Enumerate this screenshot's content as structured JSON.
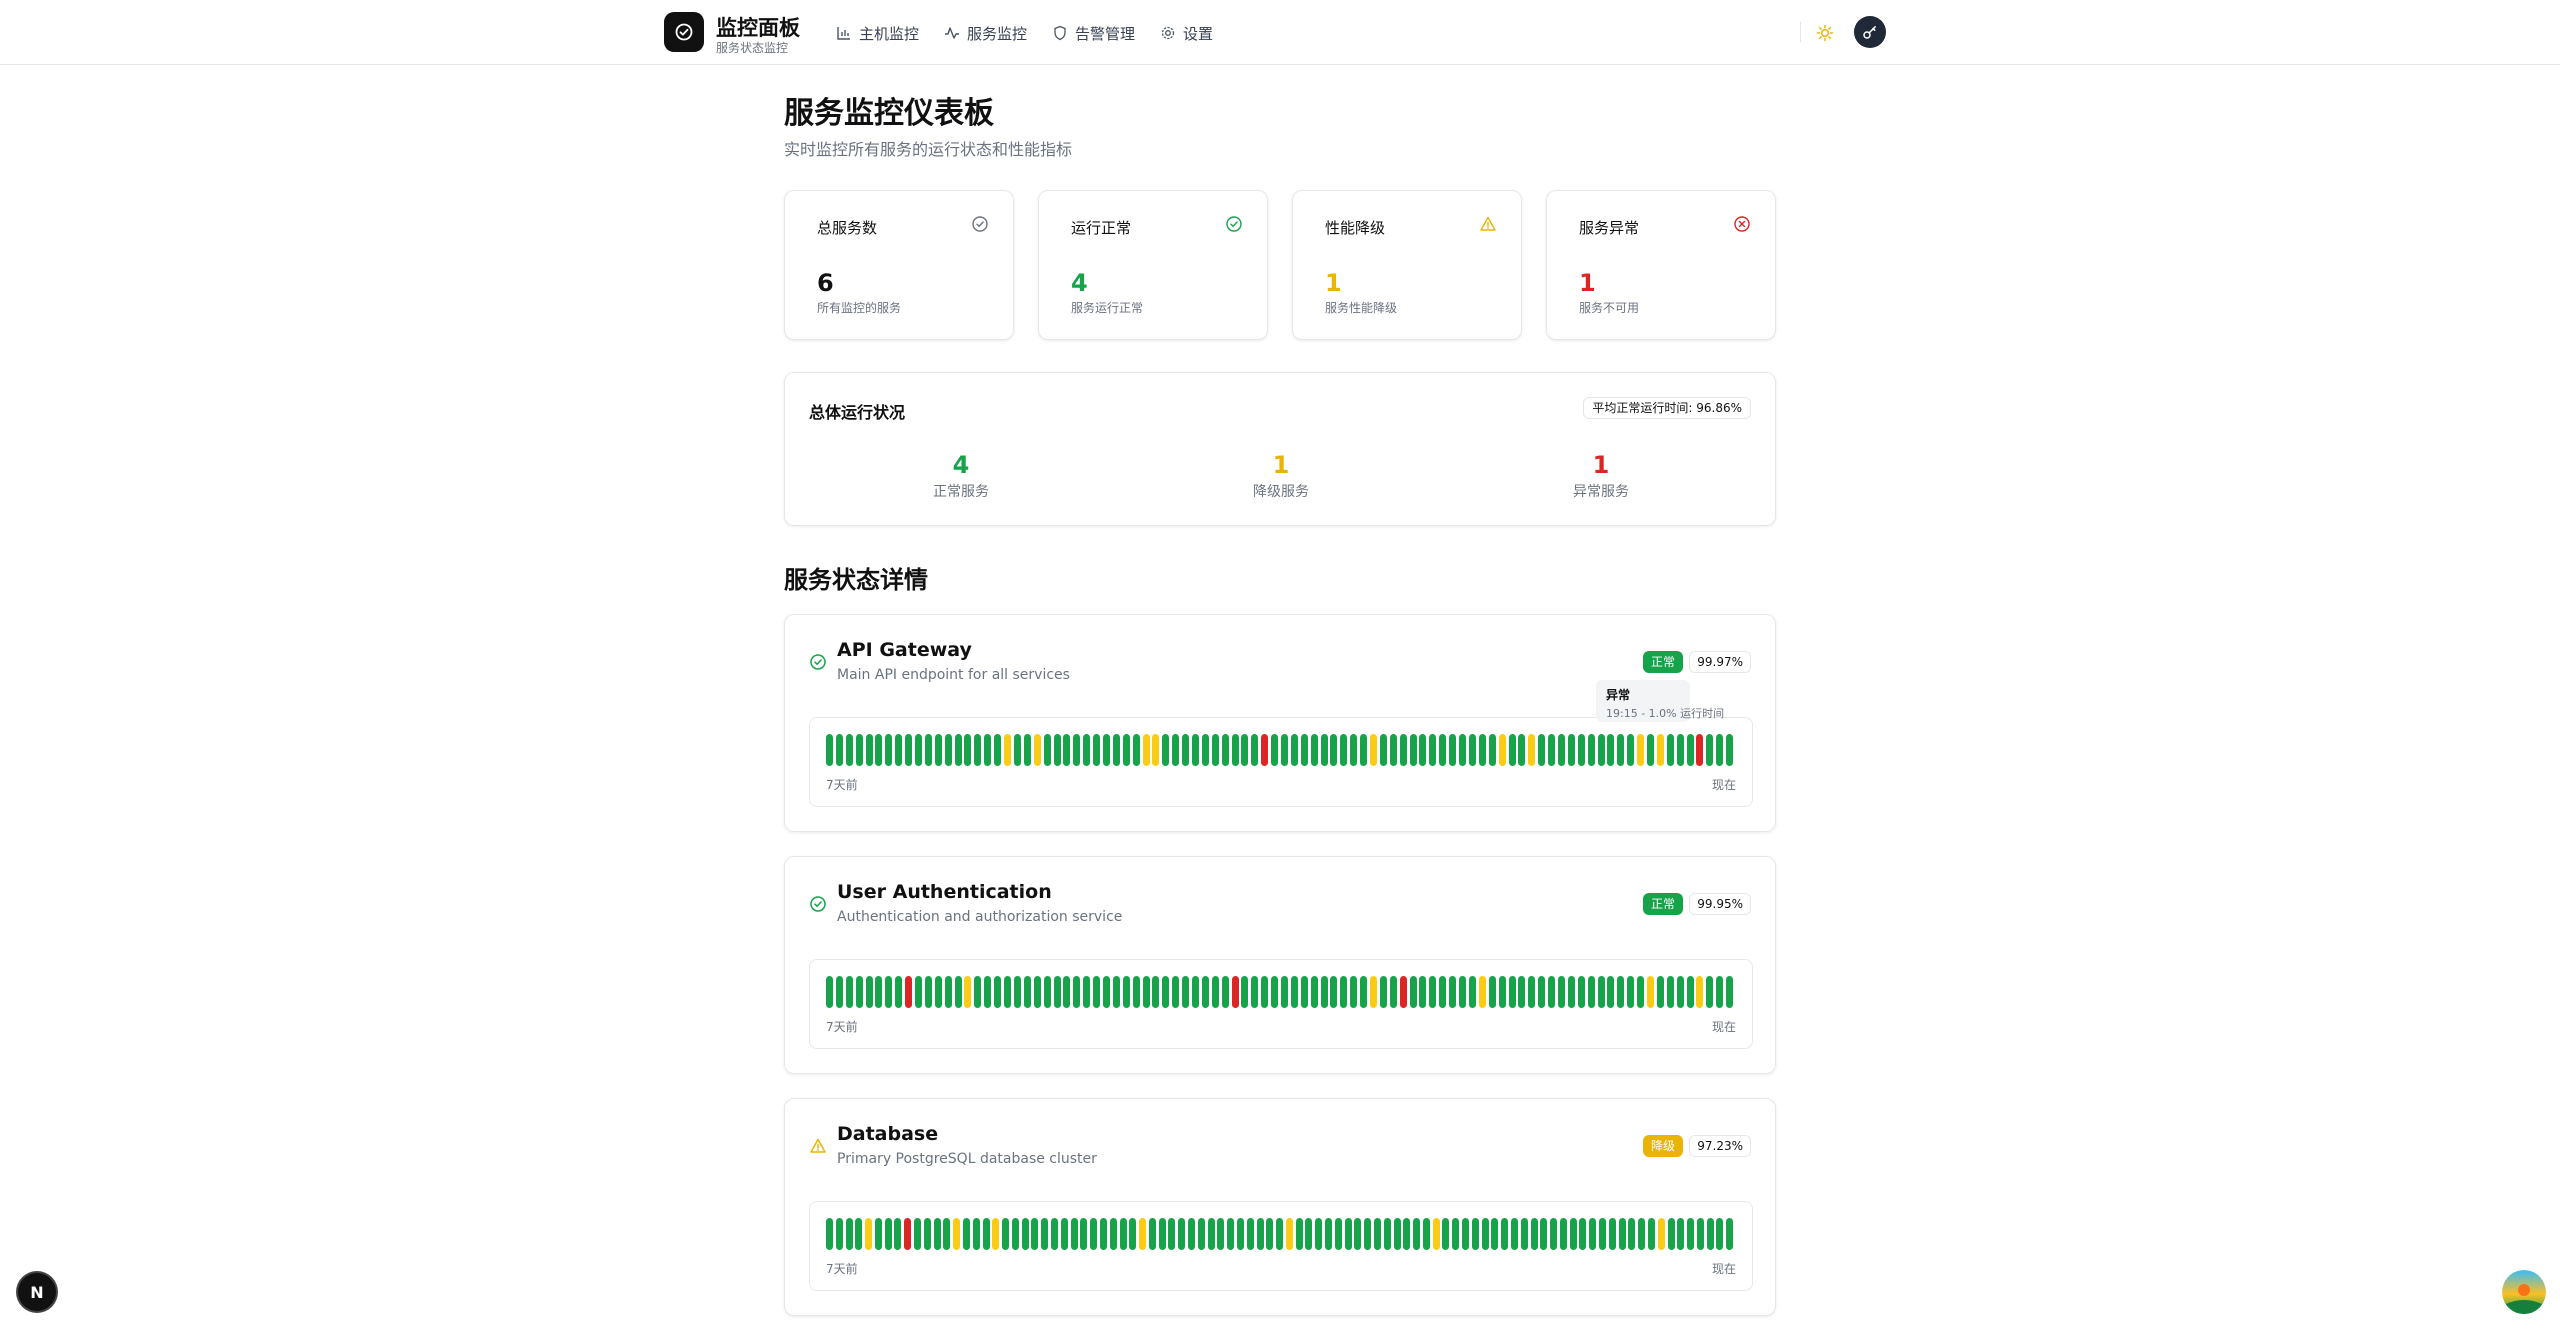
{
  "header": {
    "brand_title": "监控面板",
    "brand_subtitle": "服务状态监控",
    "nav": [
      {
        "label": "主机监控",
        "icon": "bar-chart-icon"
      },
      {
        "label": "服务监控",
        "icon": "activity-icon"
      },
      {
        "label": "告警管理",
        "icon": "shield-icon"
      },
      {
        "label": "设置",
        "icon": "gear-icon"
      }
    ],
    "theme_icon": "sun-icon",
    "user_icon": "key-icon"
  },
  "page": {
    "title": "服务监控仪表板",
    "subtitle": "实时监控所有服务的运行状态和性能指标"
  },
  "stats": [
    {
      "label": "总服务数",
      "value": "6",
      "note": "所有监控的服务",
      "color": "#111111",
      "icon": "check-circle-icon"
    },
    {
      "label": "运行正常",
      "value": "4",
      "note": "服务运行正常",
      "color": "#16a34a",
      "icon": "check-circle-icon"
    },
    {
      "label": "性能降级",
      "value": "1",
      "note": "服务性能降级",
      "color": "#eab308",
      "icon": "warning-icon"
    },
    {
      "label": "服务异常",
      "value": "1",
      "note": "服务不可用",
      "color": "#dc2626",
      "icon": "x-circle-icon"
    }
  ],
  "overall": {
    "title": "总体运行状况",
    "uptime_badge": "平均正常运行时间: 96.86%",
    "columns": [
      {
        "value": "4",
        "label": "正常服务",
        "color": "#16a34a"
      },
      {
        "value": "1",
        "label": "降级服务",
        "color": "#eab308"
      },
      {
        "value": "1",
        "label": "异常服务",
        "color": "#dc2626"
      }
    ]
  },
  "section_title": "服务状态详情",
  "status_colors": {
    "up": "#16a34a",
    "degraded": "#facc15",
    "down": "#dc2626"
  },
  "services": [
    {
      "name": "API Gateway",
      "description": "Main API endpoint for all services",
      "status_label": "正常",
      "status": "up",
      "uptime": "99.97%",
      "axis_start": "7天前",
      "axis_end": "现在",
      "history": "ggggggggggggggggggyggyggggggggggyyggggggggggrggggggggggyggggggggggggyggyggggggggggygygggrggg"
    },
    {
      "name": "User Authentication",
      "description": "Authentication and authorization service",
      "status_label": "正常",
      "status": "up",
      "uptime": "99.95%",
      "axis_start": "7天前",
      "axis_end": "现在",
      "history": "ggggggggrgggggyggggggggggggggggggggggggggrgggggggggggggyggrgggggggyggggggggggggggggyggggyggg"
    },
    {
      "name": "Database",
      "description": "Primary PostgreSQL database cluster",
      "status_label": "降级",
      "status": "degraded",
      "uptime": "97.23%",
      "axis_start": "7天前",
      "axis_end": "现在",
      "history": "ggggygggrggggygggyggggggggggggggyggggggggggggggyggggggggggggggyggggggggggggggggggggggyggggggg"
    }
  ],
  "tooltip": {
    "title": "异常",
    "detail": "19:15 - 1.0% 运行时间"
  },
  "floating": {
    "next_badge": "N"
  }
}
